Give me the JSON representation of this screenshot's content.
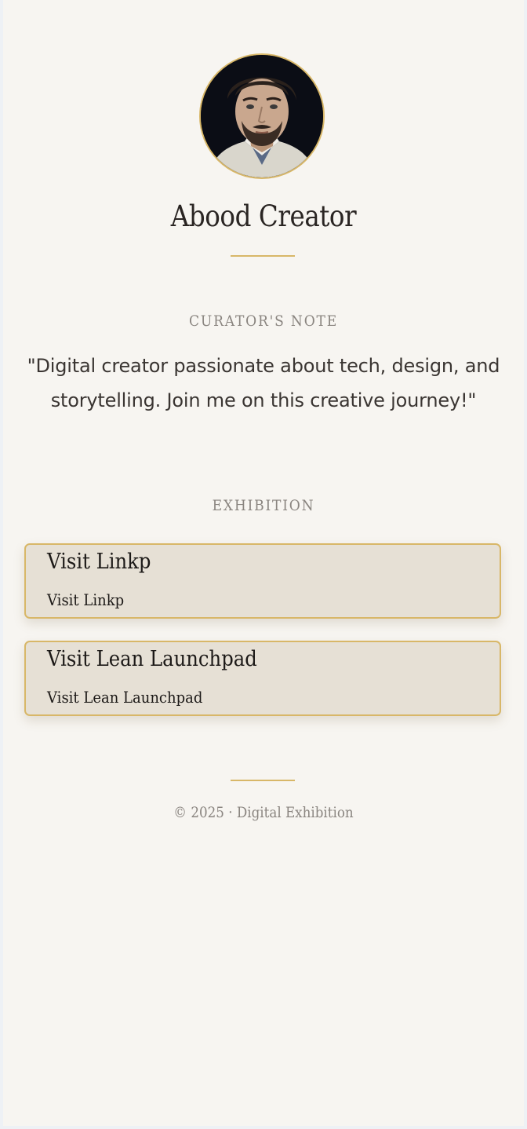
{
  "profile": {
    "name": "Abood Creator",
    "avatar_alt": "profile-photo"
  },
  "curator": {
    "heading": "CURATOR'S NOTE",
    "note": "\"Digital creator passionate about tech, design, and storytelling. Join me on this creative journey!\""
  },
  "exhibition": {
    "heading": "EXHIBITION",
    "links": [
      {
        "title": "Visit Linkp",
        "subtitle": "Visit Linkp"
      },
      {
        "title": "Visit Lean Launchpad",
        "subtitle": "Visit Lean Launchpad"
      }
    ]
  },
  "footer": {
    "text": "© 2025 · Digital Exhibition"
  },
  "colors": {
    "background": "#f7f5f1",
    "accent_gold": "#d8b768",
    "card_fill": "#e6e0d5",
    "text_dark": "#2a2523",
    "text_muted": "#8a8580"
  }
}
